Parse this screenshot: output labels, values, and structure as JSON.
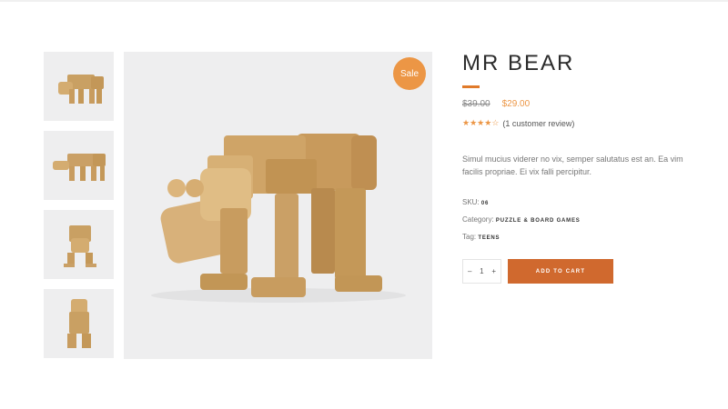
{
  "product": {
    "title": "MR BEAR",
    "old_price": "$39.00",
    "new_price": "$29.00",
    "rating": 4,
    "rating_max": 5,
    "review_text": "(1 customer review)",
    "description": "Simul mucius viderer no vix, semper salutatus est an. Ea vim facilis propriae. Ei vix falli percipitur.",
    "sale_badge": "Sale",
    "accent_color": "#ec9645",
    "button_color": "#d0692e"
  },
  "meta": {
    "sku_label": "SKU:",
    "sku_value": "06",
    "category_label": "Category:",
    "category_value": "PUZZLE & BOARD GAMES",
    "tag_label": "Tag:",
    "tag_value": "TEENS"
  },
  "cart": {
    "minus": "–",
    "quantity": "1",
    "plus": "+",
    "add_label": "ADD TO CART"
  },
  "gallery": {
    "thumbnails": [
      "bear-front-left",
      "bear-side",
      "bear-front",
      "bear-back"
    ]
  }
}
